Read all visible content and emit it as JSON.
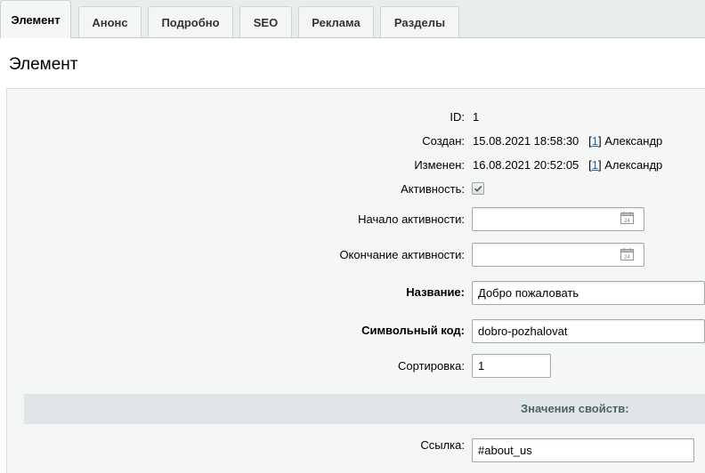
{
  "tabs": [
    {
      "label": "Элемент"
    },
    {
      "label": "Анонс"
    },
    {
      "label": "Подробно"
    },
    {
      "label": "SEO"
    },
    {
      "label": "Реклама"
    },
    {
      "label": "Разделы"
    }
  ],
  "heading": "Элемент",
  "fields": {
    "id": {
      "label": "ID:",
      "value": "1"
    },
    "created": {
      "label": "Создан:",
      "date": "15.08.2021 18:58:30",
      "user_open": "[",
      "user_id": "1",
      "user_close": "]",
      "user_name": "Александр"
    },
    "modified": {
      "label": "Изменен:",
      "date": "16.08.2021 20:52:05",
      "user_open": "[",
      "user_id": "1",
      "user_close": "]",
      "user_name": "Александр"
    },
    "active": {
      "label": "Активность:",
      "checked": true
    },
    "active_from": {
      "label": "Начало активности:",
      "value": "",
      "calendar_day": "24"
    },
    "active_to": {
      "label": "Окончание активности:",
      "value": "",
      "calendar_day": "24"
    },
    "name": {
      "label": "Название:",
      "value": "Добро пожаловать"
    },
    "code": {
      "label": "Символьный код:",
      "value": "dobro-pozhalovat"
    },
    "sort": {
      "label": "Сортировка:",
      "value": "1"
    },
    "properties_header": "Значения свойств:",
    "link": {
      "label": "Ссылка:",
      "value": "#about_us"
    }
  }
}
